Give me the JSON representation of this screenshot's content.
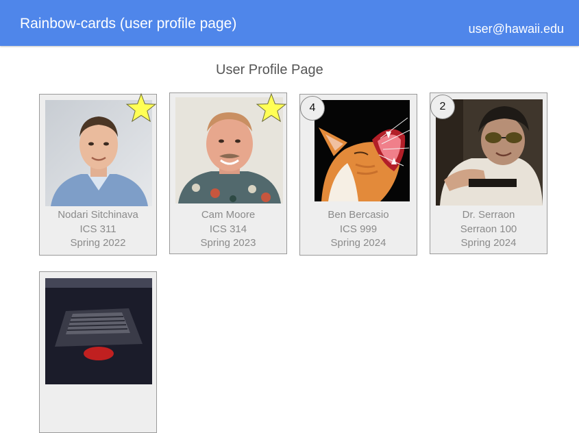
{
  "header": {
    "title": "Rainbow-cards (user profile page)",
    "user_email": "user@hawaii.edu",
    "background_color": "#4f86ea"
  },
  "main": {
    "heading": "User Profile Page",
    "cards": [
      {
        "name": "Nodari Sitchinava",
        "course": "ICS 311",
        "term": "Spring 2022",
        "badge": "star-icon"
      },
      {
        "name": "Cam Moore",
        "course": "ICS 314",
        "term": "Spring 2023",
        "badge": "star-icon"
      },
      {
        "name": "Ben Bercasio",
        "course": "ICS 999",
        "term": "Spring 2024",
        "count": "4"
      },
      {
        "name": "Dr. Serraon",
        "course": "Serraon 100",
        "term": "Spring 2024",
        "count": "2"
      },
      {
        "name": "",
        "course": "",
        "term": ""
      }
    ]
  },
  "colors": {
    "star": "#ffff55",
    "card_background": "#eeeeee"
  }
}
